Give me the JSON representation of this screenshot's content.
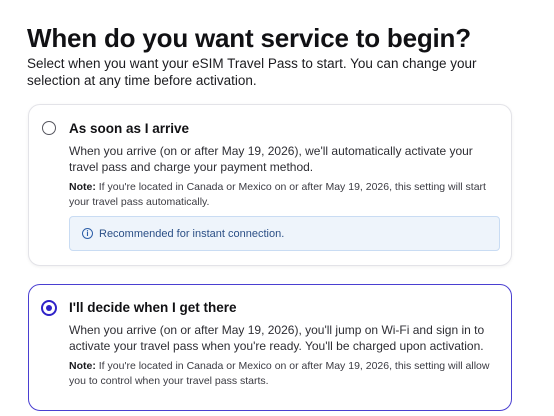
{
  "page": {
    "title": "When do you want service to begin?",
    "subtitle": "Select when you want your eSIM Travel Pass to start. You can change your selection at any time before activation."
  },
  "options": [
    {
      "label": "As soon as I arrive",
      "selected": false,
      "description": "When you arrive (on or after May 19, 2026), we'll automatically activate your travel pass and charge your payment method.",
      "note_label": "Note:",
      "note_text": " If you're located in Canada or Mexico on or after May 19, 2026, this setting will start your travel pass automatically.",
      "info_icon": "info-icon",
      "info_text": "Recommended for instant connection."
    },
    {
      "label": "I'll decide when I get there",
      "selected": true,
      "description": "When you arrive (on or after May 19, 2026), you'll jump on Wi-Fi and sign in to activate your travel pass when you're ready. You'll be charged upon activation.",
      "note_label": "Note:",
      "note_text": " If you're located in Canada or Mexico on or after May 19, 2026, this setting will allow you to control when your travel pass starts."
    }
  ],
  "colors": {
    "accent": "#2f22c8",
    "selected_border": "#4a3fd1",
    "info_bg": "#eef4fb",
    "info_text": "#2b4f86"
  }
}
